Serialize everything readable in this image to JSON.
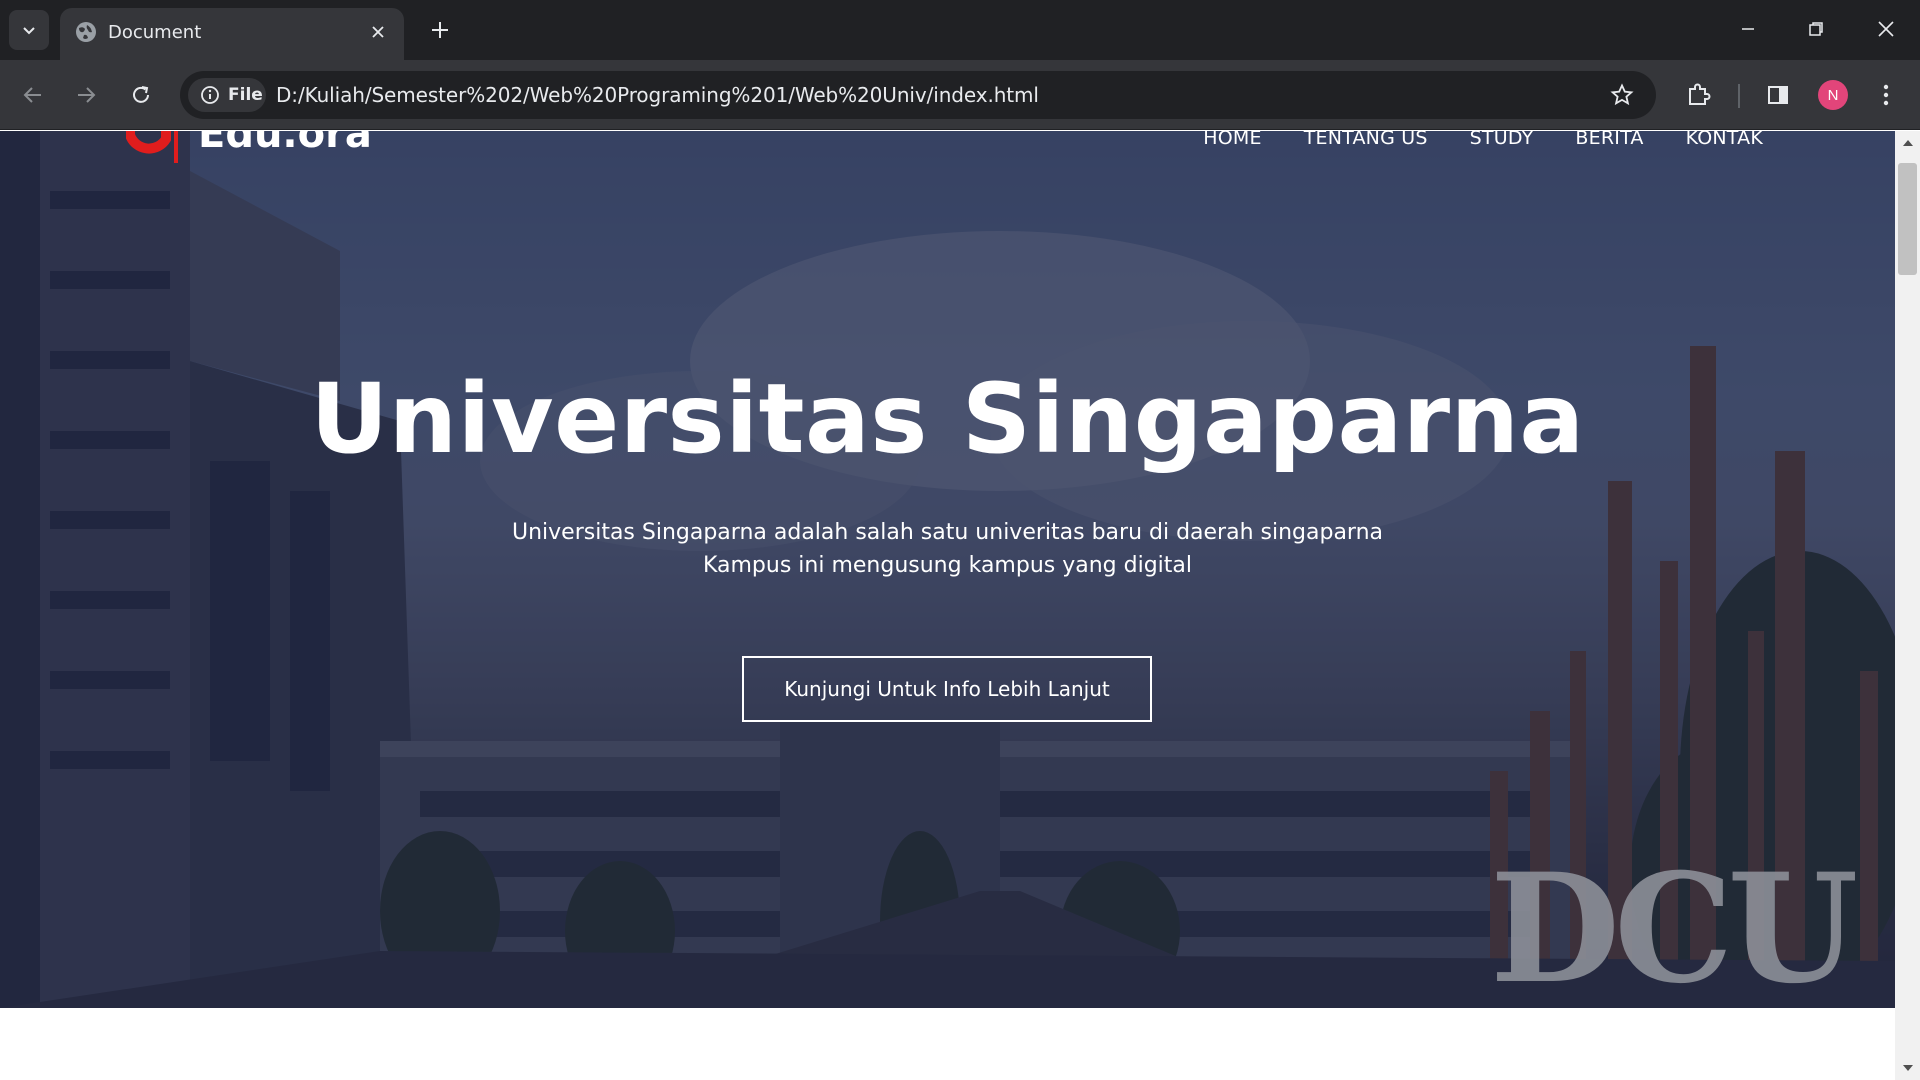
{
  "browser": {
    "tab_title": "Document",
    "site_chip_label": "File",
    "url": "D:/Kuliah/Semester%202/Web%20Programing%201/Web%20Univ/index.html",
    "profile_initial": "N"
  },
  "site": {
    "logo_text": "Edu.ora",
    "nav": [
      "HOME",
      "TENTANG US",
      "STUDY",
      "BERITA",
      "KONTAK"
    ],
    "hero": {
      "title": "Universitas Singaparna",
      "desc_line1": "Universitas Singaparna adalah salah satu univeritas baru di daerah singaparna",
      "desc_line2": "Kampus ini mengusung kampus yang digital",
      "cta": "Kunjungi Untuk Info Lebih Lanjut",
      "sign_text": "DCU"
    }
  },
  "colors": {
    "chrome_dark": "#202124",
    "chrome_mid": "#35363a",
    "overlay": "#181e40",
    "logo_accent": "#e01d1d",
    "avatar": "#e2457a"
  }
}
